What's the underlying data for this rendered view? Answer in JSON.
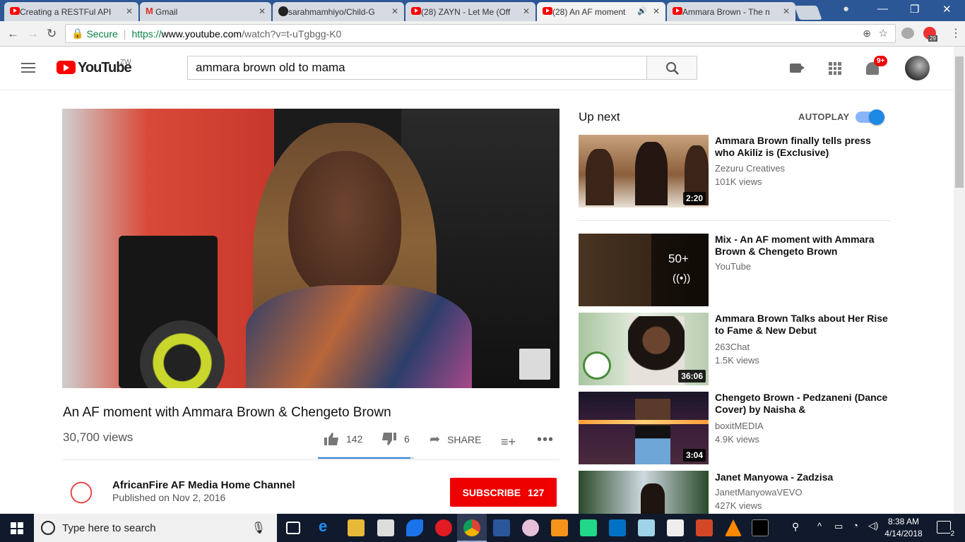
{
  "browser": {
    "tabs": [
      {
        "title": "Creating a RESTFul API",
        "icon": "youtube-icon"
      },
      {
        "title": "Gmail",
        "icon": "gmail-icon"
      },
      {
        "title": "sarahmamhiyo/Child-G",
        "icon": "github-icon"
      },
      {
        "title": "(28) ZAYN - Let Me (Off",
        "icon": "youtube-icon"
      },
      {
        "title": "(28) An AF moment",
        "icon": "youtube-icon",
        "active": true
      },
      {
        "title": "Ammara Brown - The n",
        "icon": "youtube-icon"
      }
    ],
    "secure_label": "Secure",
    "url_scheme": "https://",
    "url_host": "www.youtube.com",
    "url_path": "/watch?v=t-uTgbgg-K0",
    "extension_badge": "29"
  },
  "youtube": {
    "logo_text": "YouTube",
    "region": "ZW",
    "search_value": "ammara brown old to mama",
    "notification_count": "9+"
  },
  "video": {
    "title": "An AF moment with Ammara Brown & Chengeto Brown",
    "views": "30,700 views",
    "likes": "142",
    "dislikes": "6",
    "share_label": "SHARE",
    "like_ratio": 0.96
  },
  "channel": {
    "name": "AfricanFire AF Media Home Channel",
    "published": "Published on Nov 2, 2016",
    "subscribe_label": "SUBSCRIBE",
    "subscriber_count": "127"
  },
  "sidebar": {
    "up_next_label": "Up next",
    "autoplay_label": "AUTOPLAY",
    "items": [
      {
        "title": "Ammara Brown finally tells press who Akiliz is (Exclusive)",
        "channel": "Zezuru Creatives",
        "views": "101K views",
        "duration": "2:20"
      },
      {
        "title": "Mix - An AF moment with Ammara Brown & Chengeto Brown",
        "channel": "YouTube",
        "views": "",
        "duration": "",
        "playlist_count": "50+"
      },
      {
        "title": "Ammara Brown Talks about Her Rise to Fame & New Debut",
        "channel": "263Chat",
        "views": "1.5K views",
        "duration": "36:06"
      },
      {
        "title": "Chengeto Brown - Pedzaneni (Dance Cover) by Naisha &",
        "channel": "boxitMEDIA",
        "views": "4.9K views",
        "duration": "3:04"
      },
      {
        "title": "Janet Manyowa - Zadzisa",
        "channel": "JanetManyowaVEVO",
        "views": "427K views",
        "duration": ""
      }
    ]
  },
  "taskbar": {
    "search_placeholder": "Type here to search",
    "time": "8:38 AM",
    "date": "4/14/2018",
    "notification_count": "2"
  }
}
